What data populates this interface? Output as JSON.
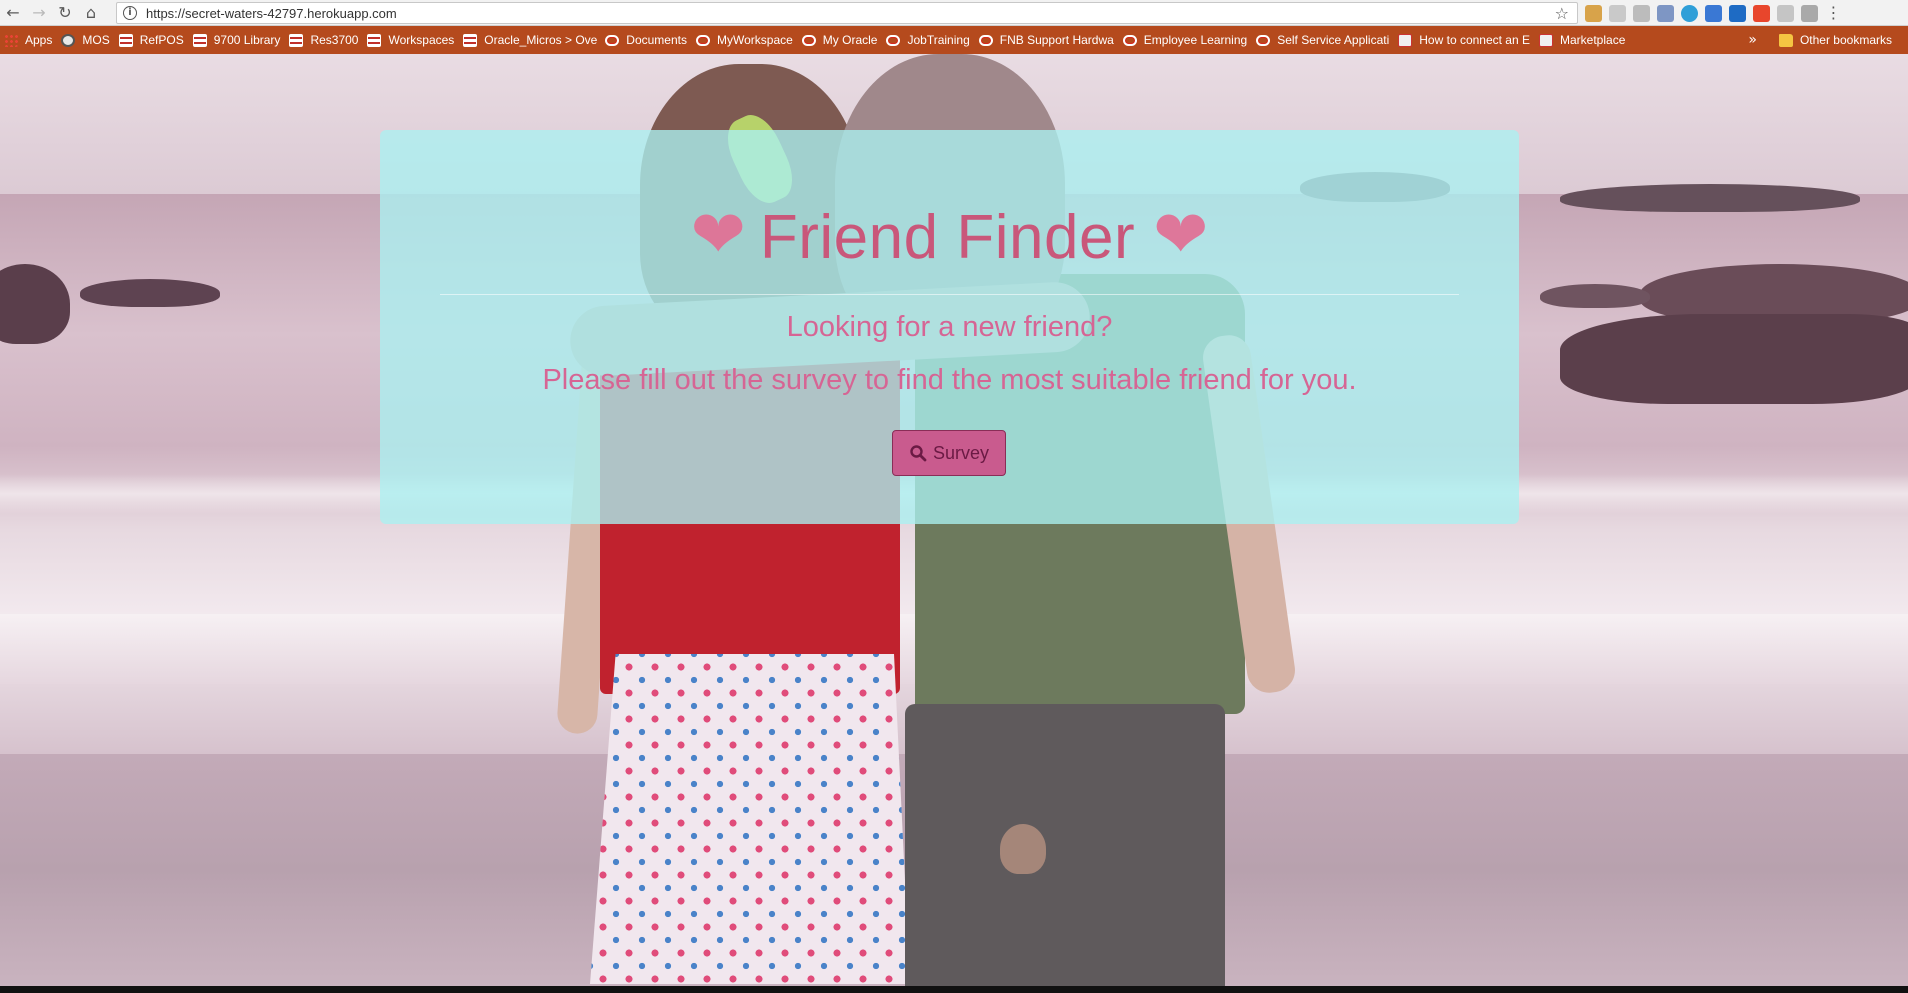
{
  "browser": {
    "url": "https://secret-waters-42797.herokuapp.com",
    "bookmarks": [
      {
        "label": "Apps",
        "icon": "apps-grid-icon"
      },
      {
        "label": "MOS",
        "icon": "globe-icon"
      },
      {
        "label": "RefPOS",
        "icon": "stack-icon"
      },
      {
        "label": "9700 Library",
        "icon": "stack-icon"
      },
      {
        "label": "Res3700",
        "icon": "stack-icon"
      },
      {
        "label": "Workspaces",
        "icon": "stack-icon"
      },
      {
        "label": "Oracle_Micros > Ove",
        "icon": "stack-icon"
      },
      {
        "label": "Documents",
        "icon": "oracle-icon"
      },
      {
        "label": "MyWorkspace",
        "icon": "oracle-icon"
      },
      {
        "label": "My Oracle",
        "icon": "oracle-icon"
      },
      {
        "label": "JobTraining",
        "icon": "oracle-icon"
      },
      {
        "label": "FNB Support Hardwa",
        "icon": "oracle-icon"
      },
      {
        "label": "Employee Learning",
        "icon": "oracle-icon"
      },
      {
        "label": "Self Service Applicati",
        "icon": "oracle-icon"
      },
      {
        "label": "How to connect an E",
        "icon": "mdi-icon"
      },
      {
        "label": "Marketplace",
        "icon": "mdi-icon"
      }
    ],
    "more_label": "»",
    "other_bookmarks": "Other bookmarks"
  },
  "page": {
    "title": "Friend Finder",
    "heart": "❤",
    "lead_1": "Looking for a new friend?",
    "lead_2": "Please fill out the survey to find the most suitable friend for you.",
    "survey_button": "Survey"
  },
  "colors": {
    "bookmark_bar": "#b54a1d",
    "jumbotron": "#abf1f1",
    "title": "#c9577a",
    "button": "#c95b8e"
  }
}
